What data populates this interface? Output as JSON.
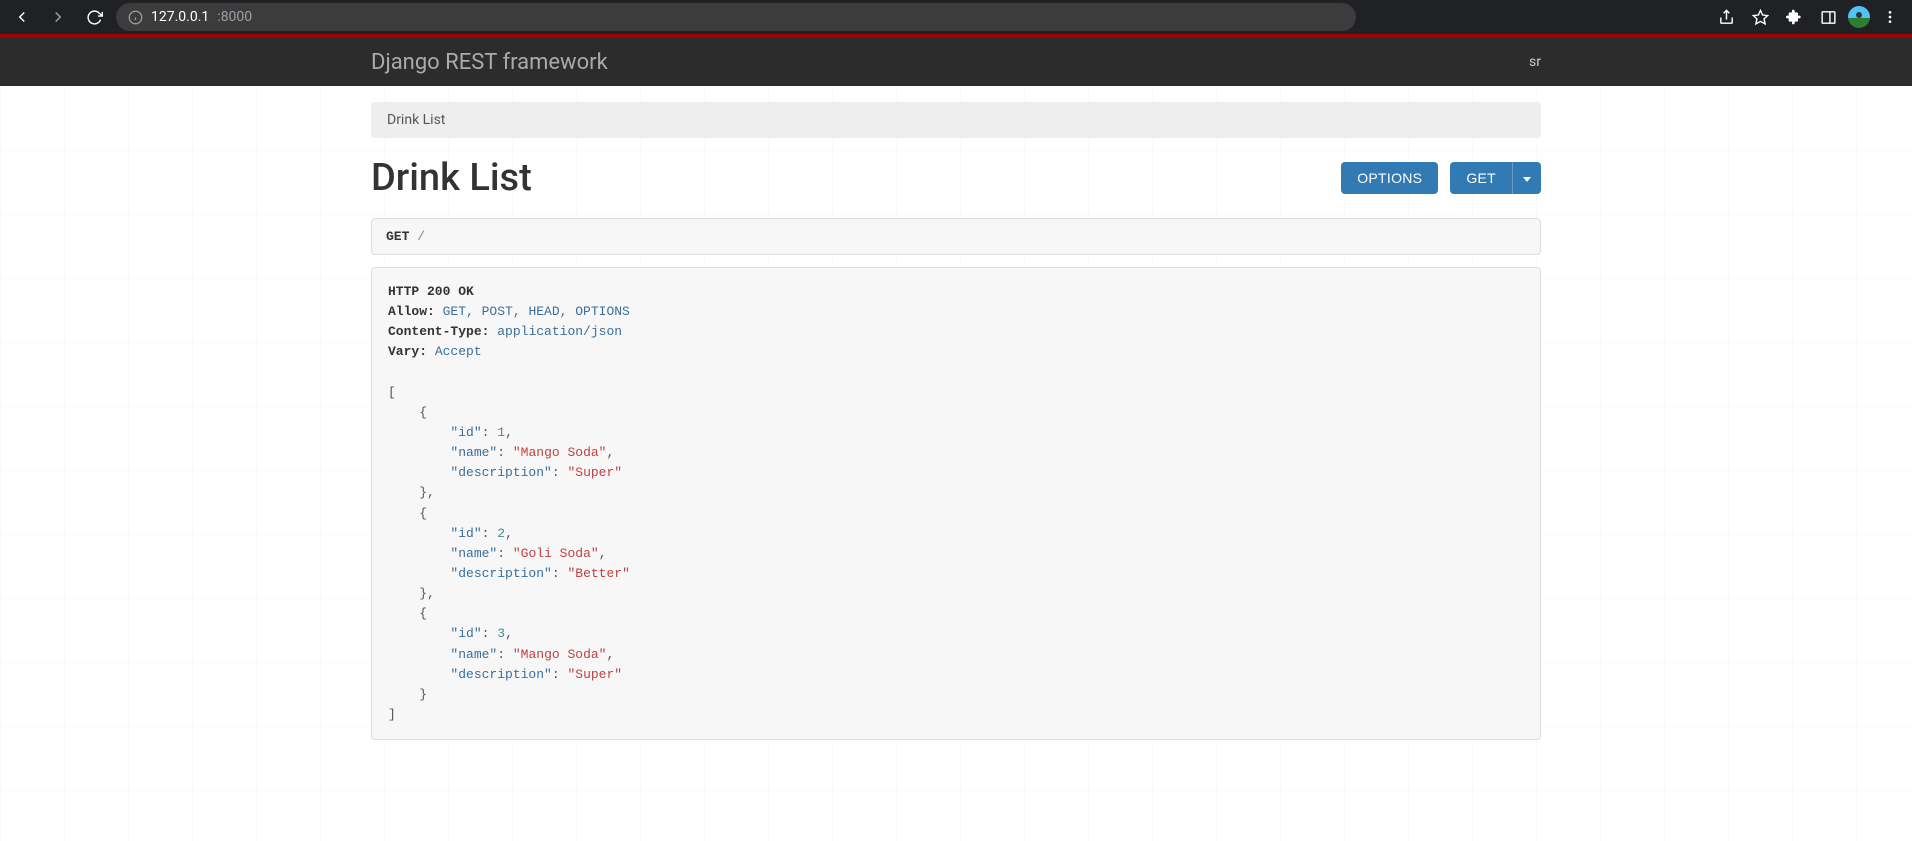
{
  "browser": {
    "url_host": "127.0.0.1",
    "url_port": ":8000"
  },
  "navbar": {
    "brand": "Django REST framework",
    "user": "sr"
  },
  "breadcrumbs": {
    "current": "Drink List"
  },
  "page": {
    "title": "Drink List",
    "options_button": "OPTIONS",
    "get_button": "GET"
  },
  "request": {
    "method": "GET",
    "path": "/"
  },
  "response": {
    "status_line": "HTTP 200 OK",
    "headers": {
      "allow_label": "Allow:",
      "allow_value": "GET, POST, HEAD, OPTIONS",
      "ctype_label": "Content-Type:",
      "ctype_value": "application/json",
      "vary_label": "Vary:",
      "vary_value": "Accept"
    },
    "body": [
      {
        "id": 1,
        "name": "Mango Soda",
        "description": "Super"
      },
      {
        "id": 2,
        "name": "Goli Soda",
        "description": "Better"
      },
      {
        "id": 3,
        "name": "Mango Soda",
        "description": "Super"
      }
    ]
  }
}
